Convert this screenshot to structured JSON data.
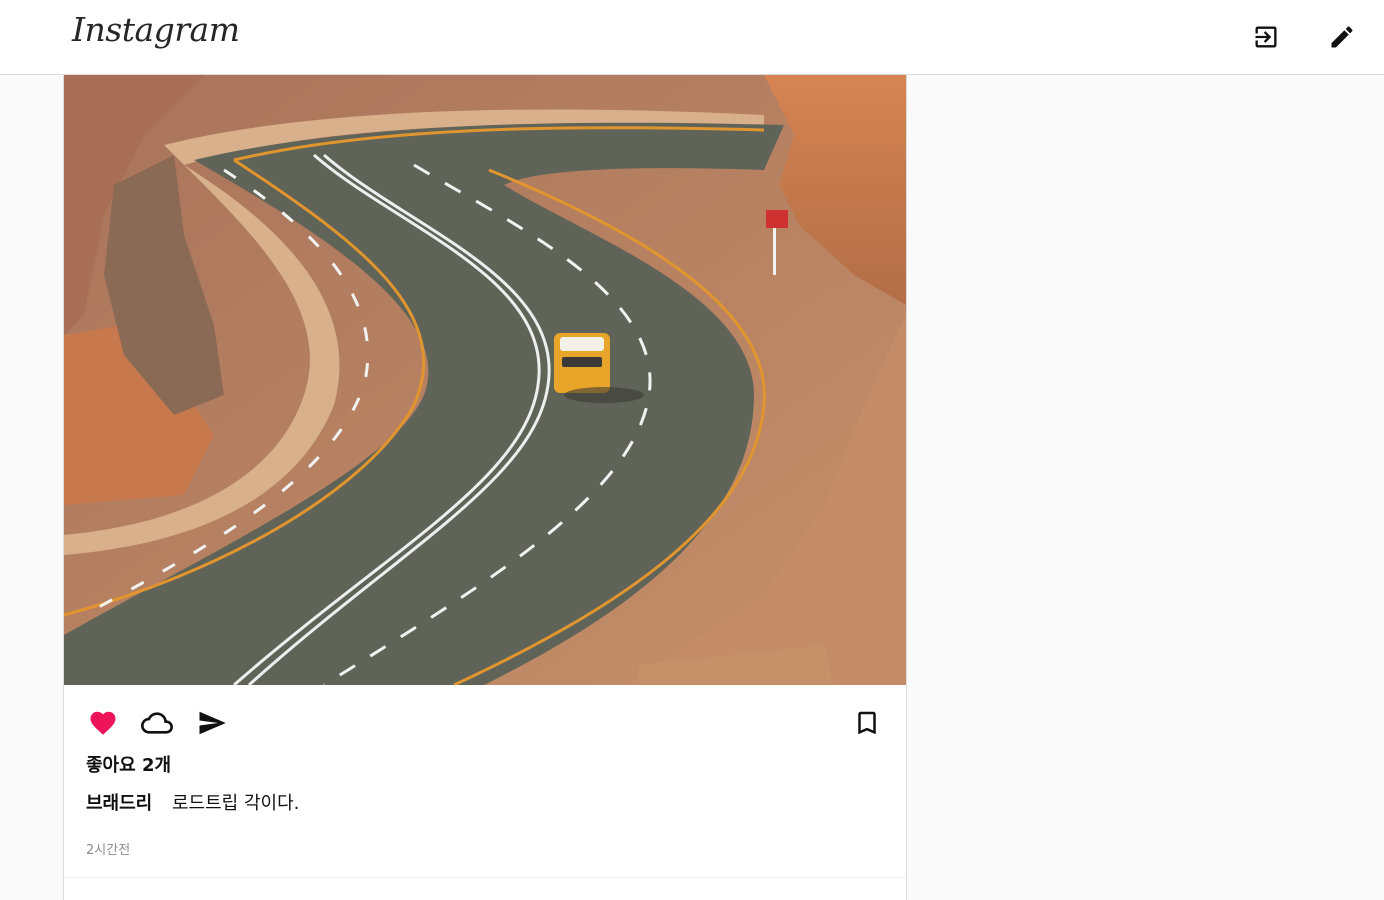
{
  "header": {
    "logo_text": "Instagram",
    "login_icon": "login-icon",
    "edit_icon": "pencil-icon"
  },
  "post": {
    "image_alt": "winding mountain road with yellow SUV",
    "actions": {
      "like_icon": "heart-icon",
      "like_color": "#ed1459",
      "comment_icon": "cloud-icon",
      "share_icon": "send-icon",
      "save_icon": "bookmark-icon"
    },
    "likes_text": "좋아요 2개",
    "author": "브래드리",
    "caption": "로드트립 각이다.",
    "time": "2시간전"
  }
}
